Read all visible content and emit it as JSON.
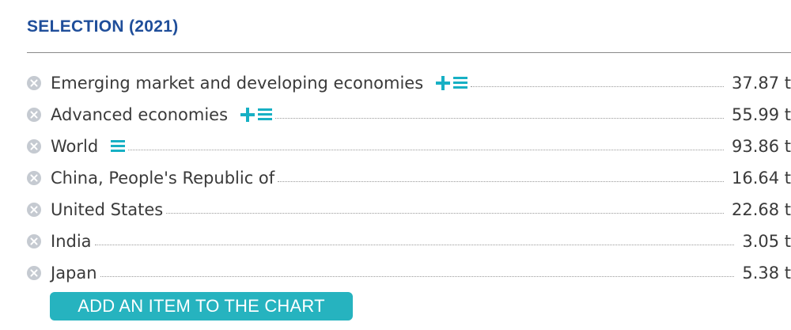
{
  "header": {
    "title": "SELECTION (2021)"
  },
  "colors": {
    "title": "#1f4e9a",
    "accent": "#17b0c4",
    "button": "#26b3bf",
    "remove": "#c5cad1"
  },
  "icons": {
    "remove": "remove-circle-x-icon",
    "add": "plus-icon",
    "expand": "list-icon"
  },
  "items": [
    {
      "label": "Emerging market and developing economies",
      "value": "37.87 t",
      "has_add": true,
      "has_expand": true
    },
    {
      "label": "Advanced economies",
      "value": "55.99 t",
      "has_add": true,
      "has_expand": true
    },
    {
      "label": "World",
      "value": "93.86 t",
      "has_add": false,
      "has_expand": true
    },
    {
      "label": "China, People's Republic of",
      "value": "16.64 t",
      "has_add": false,
      "has_expand": false
    },
    {
      "label": "United States",
      "value": "22.68 t",
      "has_add": false,
      "has_expand": false
    },
    {
      "label": "India",
      "value": "3.05 t",
      "has_add": false,
      "has_expand": false
    },
    {
      "label": "Japan",
      "value": "5.38 t",
      "has_add": false,
      "has_expand": false
    }
  ],
  "actions": {
    "add_item_label": "ADD AN ITEM TO THE CHART"
  }
}
